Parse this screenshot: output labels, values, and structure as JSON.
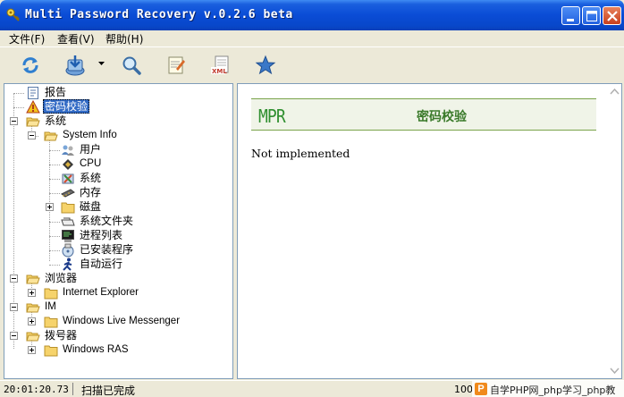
{
  "window": {
    "title": "Multi Password Recovery v.0.2.6 beta",
    "controls": [
      {
        "name": "minimize-button",
        "icon": "minimize-icon"
      },
      {
        "name": "maximize-button",
        "icon": "maximize-icon"
      },
      {
        "name": "close-button",
        "icon": "close-icon"
      }
    ]
  },
  "menu": [
    "文件(F)",
    "查看(V)",
    "帮助(H)"
  ],
  "toolbar": [
    {
      "name": "refresh-button",
      "icon": "refresh-icon"
    },
    {
      "name": "import-button",
      "icon": "import-icon",
      "has_dropdown": true
    },
    {
      "name": "search-button",
      "icon": "magnifier-icon"
    },
    {
      "name": "notes-button",
      "icon": "notepad-icon"
    },
    {
      "name": "export-xml-button",
      "icon": "xml-icon"
    },
    {
      "name": "favorite-button",
      "icon": "star-icon"
    }
  ],
  "tree": {
    "report": "报告",
    "verify": "密码校验",
    "system": "系统",
    "system_info": "System Info",
    "users": "用户",
    "cpu": "CPU",
    "system_item": "系统",
    "memory": "内存",
    "disk": "磁盘",
    "system_folders": "系统文件夹",
    "process_list": "进程列表",
    "installed": "已安装程序",
    "autorun": "自动运行",
    "browsers": "浏览器",
    "ie": "Internet Explorer",
    "im": "IM",
    "messenger": "Windows Live Messenger",
    "dialer": "拨号器",
    "ras": "Windows RAS"
  },
  "content": {
    "logo": "MPR",
    "title": "密码校验",
    "message": "Not implemented"
  },
  "status": {
    "time": "20:01:20.73",
    "text": "扫描已完成",
    "right": "100",
    "watermark": "自学PHP网_php学习_php教"
  },
  "colors": {
    "titlebar": "#0a4cd6",
    "selection": "#316ac5",
    "header_green": "#3a7a2a",
    "folder": "#f6d36b"
  }
}
